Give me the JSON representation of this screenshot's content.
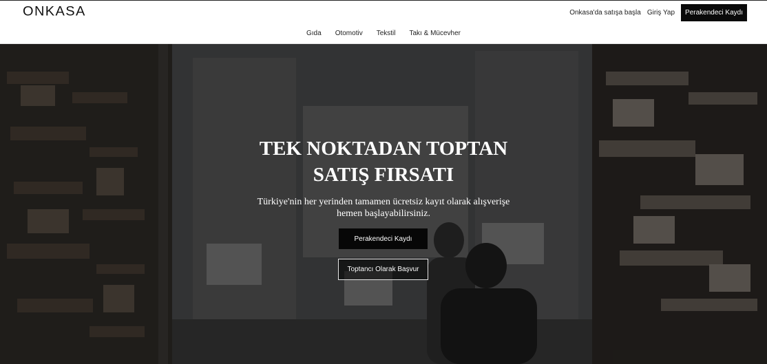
{
  "header": {
    "logo": "ONKASA",
    "links": {
      "sell": "Onkasa'da satışa başla",
      "login": "Giriş Yap",
      "retailer_signup": "Perakendeci Kaydı"
    },
    "categories": [
      "Gıda",
      "Otomotiv",
      "Tekstil",
      "Takı & Mücevher"
    ]
  },
  "hero": {
    "title_line1": "TEK NOKTADAN TOPTAN",
    "title_line2": "SATIŞ FIRSATI",
    "subtitle_line1": "Türkiye'nin her yerinden tamamen ücretsiz kayıt olarak alışverişe",
    "subtitle_line2": "hemen başlayabilirsiniz.",
    "primary_button": "Perakendeci Kaydı",
    "secondary_button": "Toptancı Olarak Başvur"
  },
  "colors": {
    "accent": "#0a0a0a",
    "hero_text": "#ffffff"
  }
}
